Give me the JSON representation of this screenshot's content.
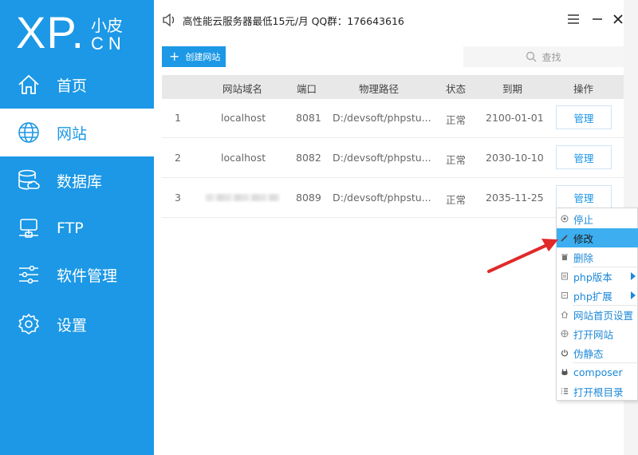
{
  "logo": {
    "xp": "XP.",
    "small": "小皮",
    "cn": "CN"
  },
  "sidebar": {
    "items": [
      {
        "label": "首页",
        "icon": "home-icon"
      },
      {
        "label": "网站",
        "icon": "globe-icon",
        "active": true
      },
      {
        "label": "数据库",
        "icon": "database-icon"
      },
      {
        "label": "FTP",
        "icon": "ftp-server-icon"
      },
      {
        "label": "软件管理",
        "icon": "sliders-icon"
      },
      {
        "label": "设置",
        "icon": "gear-icon"
      }
    ]
  },
  "titlebar": {
    "ad_text": "高性能云服务器最低15元/月 QQ群：176643616",
    "menu_icon": "hamburger-icon",
    "minimize_icon": "minimize-icon",
    "close_icon": "close-icon"
  },
  "toolbar": {
    "create_label": "创建网站",
    "search_placeholder": "查找"
  },
  "table": {
    "headers": [
      "网站域名",
      "端口",
      "物理路径",
      "状态",
      "到期",
      "操作"
    ],
    "rows": [
      {
        "index": "1",
        "domain": "localhost",
        "port": "8081",
        "path": "D:/devsoft/phpstu...",
        "status": "正常",
        "expiry": "2100-01-01",
        "action": "管理"
      },
      {
        "index": "2",
        "domain": "localhost",
        "port": "8082",
        "path": "D:/devsoft/phpstu...",
        "status": "正常",
        "expiry": "2030-10-10",
        "action": "管理"
      },
      {
        "index": "3",
        "domain": "",
        "port": "8089",
        "path": "D:/devsoft/phpstu...",
        "status": "正常",
        "expiry": "2035-11-25",
        "action": "管理"
      }
    ]
  },
  "context_menu": {
    "items": [
      {
        "label": "停止",
        "icon": "stop-icon"
      },
      {
        "label": "修改",
        "icon": "pencil-icon",
        "highlighted": true
      },
      {
        "label": "删除",
        "icon": "trash-icon"
      },
      {
        "label": "php版本",
        "icon": "php-version-icon",
        "submenu": true
      },
      {
        "label": "php扩展",
        "icon": "php-extension-icon",
        "submenu": true
      },
      {
        "label": "网站首页设置",
        "icon": "homepage-icon"
      },
      {
        "label": "打开网站",
        "icon": "globe-small-icon"
      },
      {
        "label": "伪静态",
        "icon": "power-icon"
      },
      {
        "label": "composer",
        "icon": "composer-icon"
      },
      {
        "label": "打开根目录",
        "icon": "list-icon"
      }
    ]
  },
  "colors": {
    "accent": "#1c98e6",
    "menu_highlight": "#3daeef",
    "arrow": "#e02a2a"
  }
}
